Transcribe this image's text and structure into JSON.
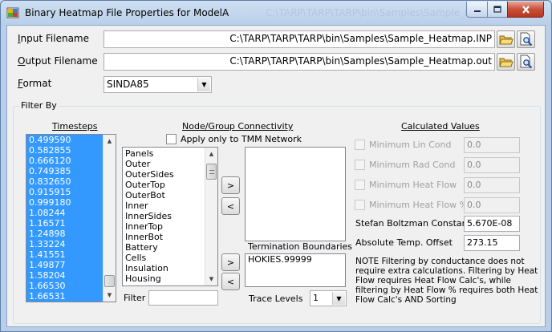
{
  "window": {
    "title": "Binary Heatmap File Properties for ModelA",
    "background_title": "C:\\TARP\\TARP\\TARP\\bin\\Samples\\Sample_Heatmap.INP"
  },
  "input_filename": {
    "label": "Input Filename",
    "value": "C:\\TARP\\TARP\\TARP\\bin\\Samples\\Sample_Heatmap.INP"
  },
  "output_filename": {
    "label": "Output Filename",
    "value": "C:\\TARP\\TARP\\TARP\\bin\\Samples\\Sample_Heatmap.out"
  },
  "format": {
    "label": "Format",
    "value": "SINDA85"
  },
  "filter_by": {
    "title": "Filter By",
    "timesteps": {
      "label": "Timesteps",
      "items": [
        "0.499590",
        "0.582855",
        "0.666120",
        "0.749385",
        "0.832650",
        "0.915915",
        "0.999180",
        "1.08244",
        "1.16571",
        "1.24898",
        "1.33224",
        "1.41551",
        "1.49877",
        "1.58204",
        "1.66530",
        "1.66531"
      ],
      "selected": "all"
    },
    "node_group": {
      "label": "Node/Group Connectivity",
      "tmm_checkbox_label": "Apply only to TMM Network",
      "tmm_checked": false,
      "groups": [
        "Panels",
        "Outer",
        "OuterSides",
        "OuterTop",
        "OuterBot",
        "Inner",
        "InnerSides",
        "InnerTop",
        "InnerBot",
        "Battery",
        "Cells",
        "Insulation",
        "Housing"
      ],
      "selected_groups": [],
      "add_label": ">",
      "remove_label": "<",
      "filter_label": "Filter",
      "filter_value": ""
    },
    "termination": {
      "label": "Termination Boundaries",
      "items": [
        "HOKIES.99999"
      ],
      "add_label": ">",
      "remove_label": "<"
    },
    "trace_levels": {
      "label": "Trace Levels",
      "value": "1"
    },
    "calculated": {
      "label": "Calculated Values",
      "min_lin_cond": {
        "label": "Minimum Lin Cond",
        "value": "0.0",
        "enabled": false
      },
      "min_rad_cond": {
        "label": "Minimum Rad Cond",
        "value": "0.0",
        "enabled": false
      },
      "min_heat_flow": {
        "label": "Minimum Heat Flow",
        "value": "0.0",
        "enabled": false
      },
      "min_heat_flow_pct": {
        "label": "Minimum Heat Flow %",
        "value": "0.0",
        "enabled": false
      },
      "stefan_boltzman": {
        "label": "Stefan Boltzman Constant",
        "value": "5.670E-08"
      },
      "abs_temp_offset": {
        "label": "Absolute Temp. Offset",
        "value": "273.15"
      },
      "note": "NOTE Filtering by conductance does not require extra calculations.  Filtering by Heat Flow requires Heat Flow Calc's, while filtering by Heat Flow % requires both Heat Flow Calc's AND Sorting"
    }
  },
  "colors": {
    "selection": "#3399ff",
    "window_frame": "#b9cfe9",
    "close_button": "#c9503a"
  }
}
